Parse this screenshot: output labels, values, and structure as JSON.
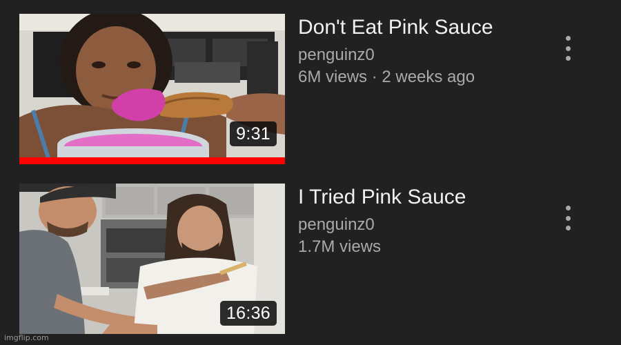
{
  "videos": [
    {
      "title": "Don't Eat Pink Sauce",
      "channel": "penguinz0",
      "stats": "6M views · 2 weeks ago",
      "duration": "9:31",
      "watched_fraction": 1.0,
      "thumbnail_icon": "pink-sauce-dip-thumbnail"
    },
    {
      "title": "I Tried Pink Sauce",
      "channel": "penguinz0",
      "stats": "1.7M views",
      "duration": "16:36",
      "watched_fraction": 0,
      "thumbnail_icon": "kitchen-tasting-thumbnail"
    }
  ],
  "watermark": "imgflip.com",
  "colors": {
    "background": "#212121",
    "title": "#f1f1f1",
    "secondary_text": "#aaaaaa",
    "progress": "#ff0000"
  }
}
